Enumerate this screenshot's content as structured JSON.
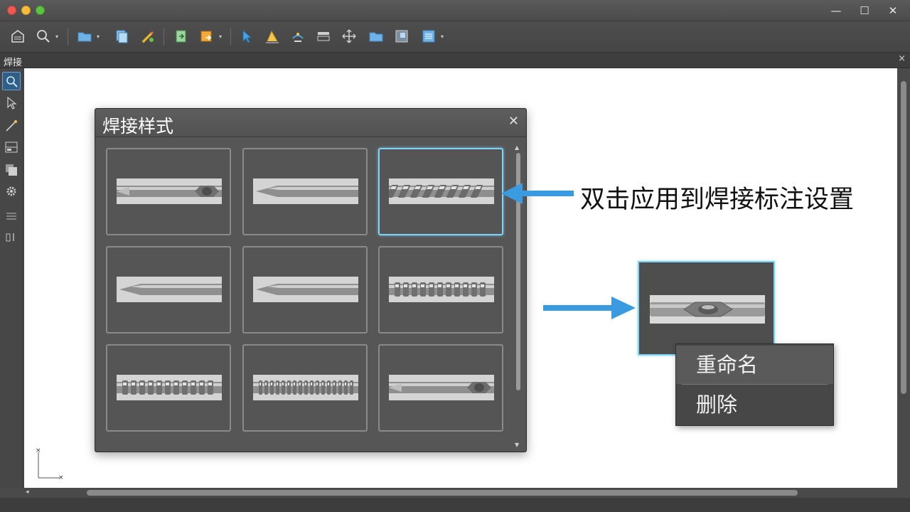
{
  "panel": {
    "title": "焊接",
    "close_glyph": "×"
  },
  "window_controls": {
    "minimize": "—",
    "maximize": "☐",
    "close": "✕"
  },
  "dialog": {
    "title": "焊接样式",
    "close_glyph": "✕",
    "styles": [
      {
        "pattern": "center-notch",
        "selected": false
      },
      {
        "pattern": "plain-taper",
        "selected": false
      },
      {
        "pattern": "spiral-wrap",
        "selected": true
      },
      {
        "pattern": "plain-taper",
        "selected": false
      },
      {
        "pattern": "plain-taper",
        "selected": false
      },
      {
        "pattern": "bead-chain",
        "selected": false
      },
      {
        "pattern": "bead-chain",
        "selected": false
      },
      {
        "pattern": "dense-bead",
        "selected": false
      },
      {
        "pattern": "center-notch",
        "selected": false
      }
    ]
  },
  "annotation": {
    "text": "双击应用到焊接标注设置",
    "arrow_color": "#3b9be0"
  },
  "context_menu": {
    "items": [
      {
        "label": "重命名"
      },
      {
        "label": "删除"
      }
    ]
  },
  "ucs": {
    "x_label": "X",
    "y_label": "Y"
  },
  "colors": {
    "selection": "#7fd3f7",
    "accent": "#3b9be0"
  }
}
